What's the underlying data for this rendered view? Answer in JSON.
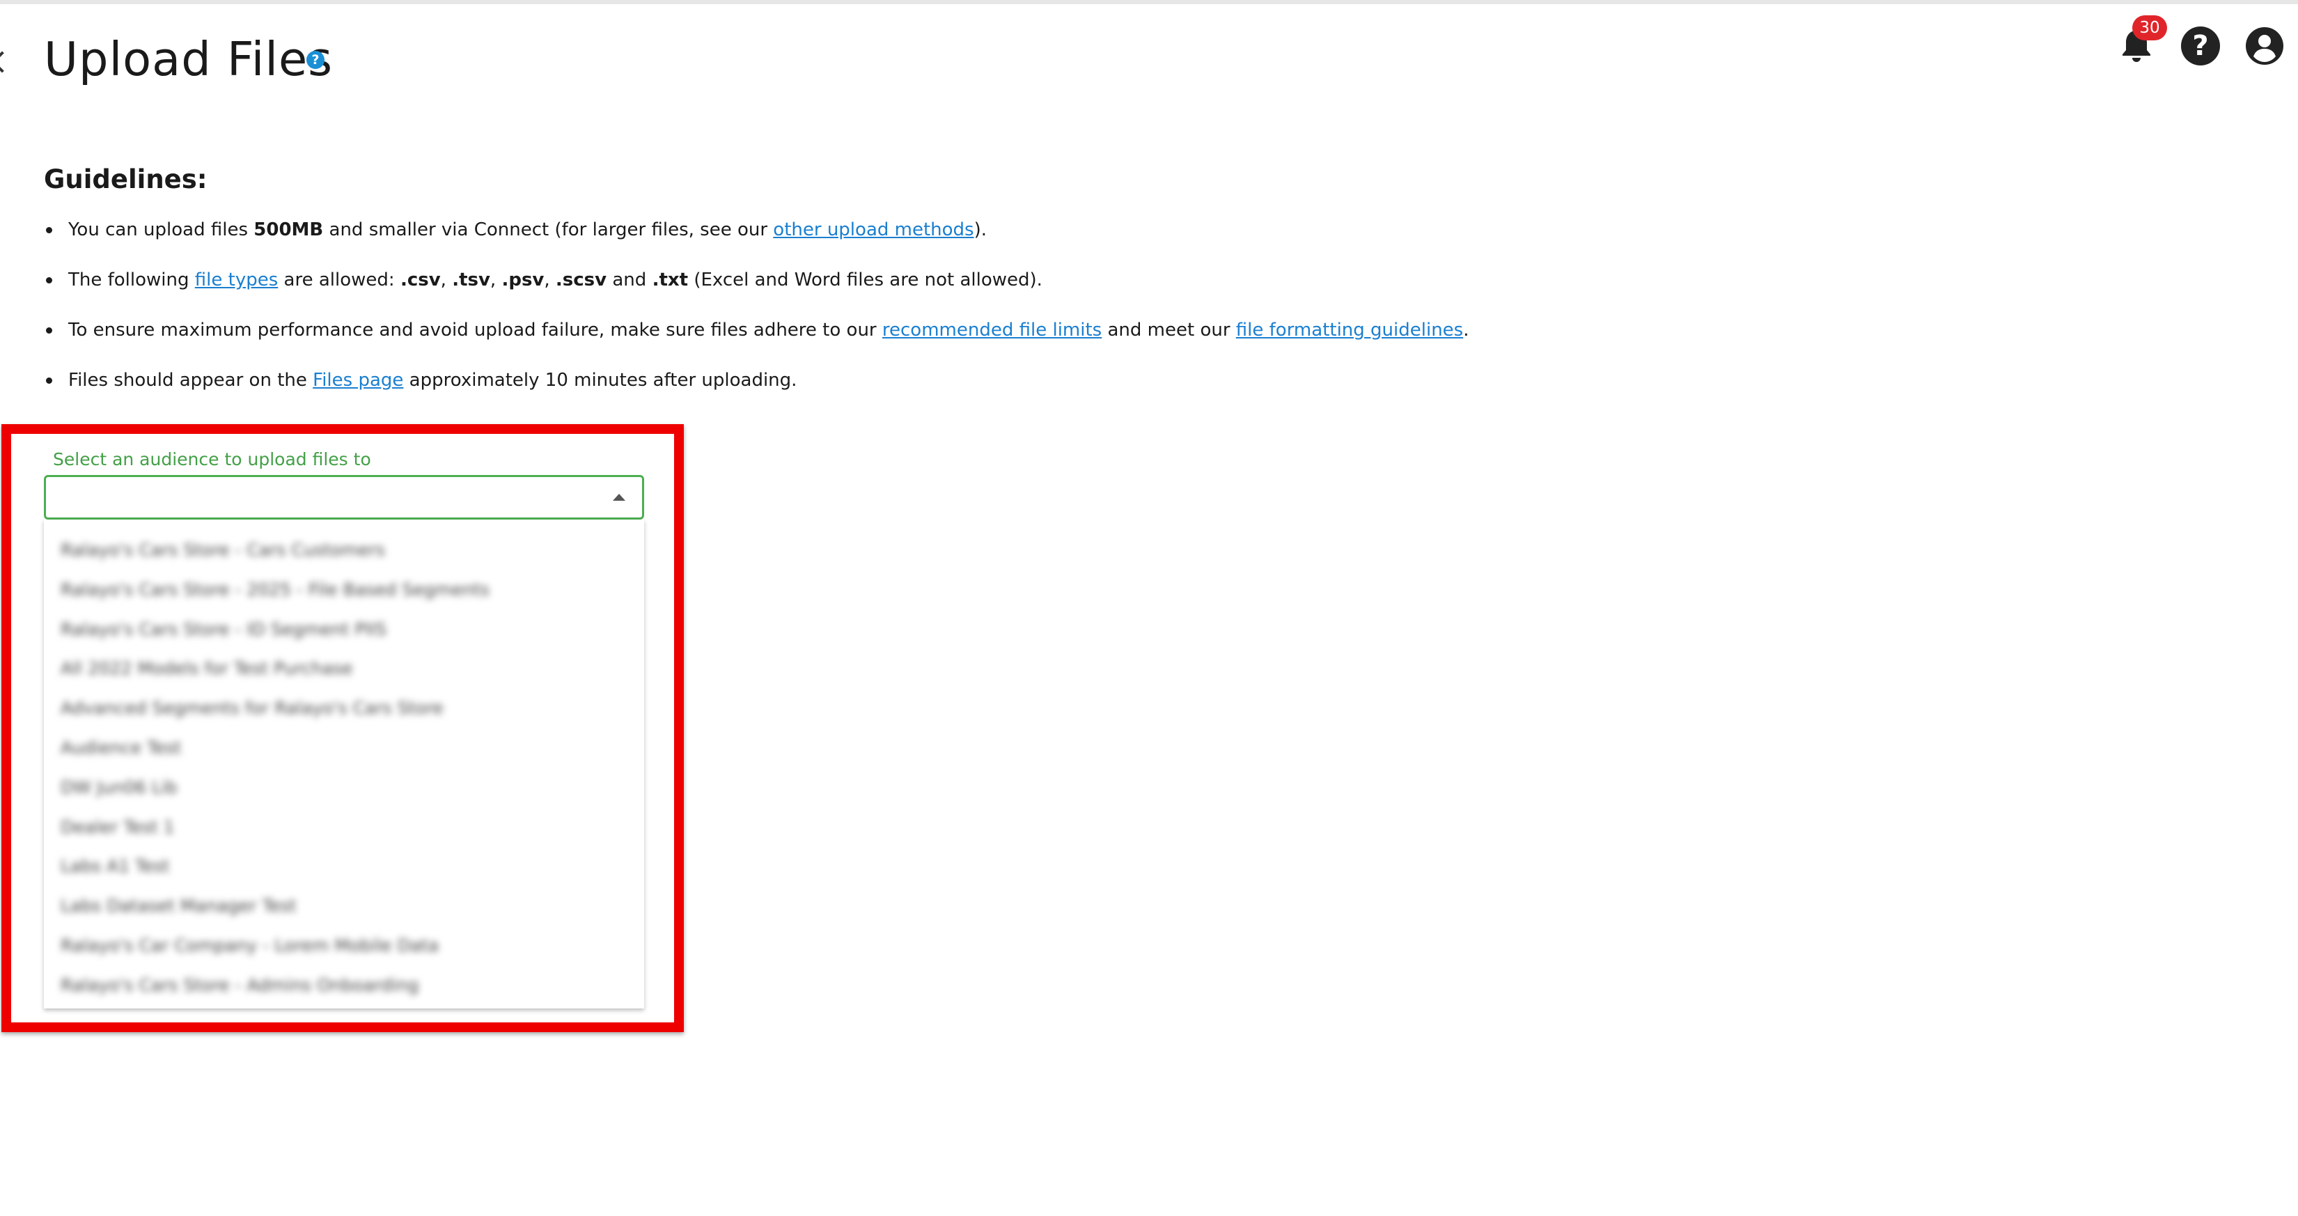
{
  "page": {
    "title": "Upload Files",
    "help_glyph": "?"
  },
  "header": {
    "notification_count": "30",
    "icons": [
      "bell-icon",
      "help-circle-icon",
      "account-circle-icon"
    ]
  },
  "guidelines": {
    "heading": "Guidelines:",
    "item1": {
      "t1": "You can upload files ",
      "b1": "500MB",
      "t2": " and smaller via Connect (for larger files, see our ",
      "link": "other upload methods",
      "t3": ")."
    },
    "item2": {
      "t1": "The following ",
      "link": "file types",
      "t2": " are allowed: ",
      "csv": ".csv",
      "sep1": ", ",
      "tsv": ".tsv",
      "sep2": ", ",
      "psv": ".psv",
      "sep3": ", ",
      "scsv": ".scsv",
      "and": " and ",
      "txt": ".txt",
      "t3": " (Excel and Word files are not allowed)."
    },
    "item3": {
      "t1": "To ensure maximum performance and avoid upload failure, make sure files adhere to our ",
      "link1": "recommended file limits",
      "t2": " and meet our ",
      "link2": "file formatting guidelines",
      "t3": "."
    },
    "item4": {
      "t1": "Files should appear on the ",
      "link": "Files page",
      "t2": " approximately 10 minutes after uploading."
    }
  },
  "audience_select": {
    "label": "Select an audience to upload files to",
    "value": "",
    "options_blurred": true,
    "options": [
      "Ralayo's Cars Store - Cars Customers",
      "Ralayo's Cars Store - 2025 - File Based Segments",
      "Ralayo's Cars Store - ID Segment PIIS",
      "All 2022 Models for Test Purchase",
      "Advanced Segments for Ralayo's Cars Store",
      "Audience Test",
      "DW Jun06 Lib",
      "Dealer Test 1",
      "Labs A1 Test",
      "Labs Dataset Manager Test",
      "Ralayo's Car Company - Lorem Mobile Data",
      "Ralayo's Cars Store - Admins Onboarding"
    ]
  },
  "colors": {
    "accent_green": "#4caf50",
    "link_blue": "#1a7fd0",
    "highlight_red": "#ee0000",
    "badge_red": "#e0252a"
  }
}
